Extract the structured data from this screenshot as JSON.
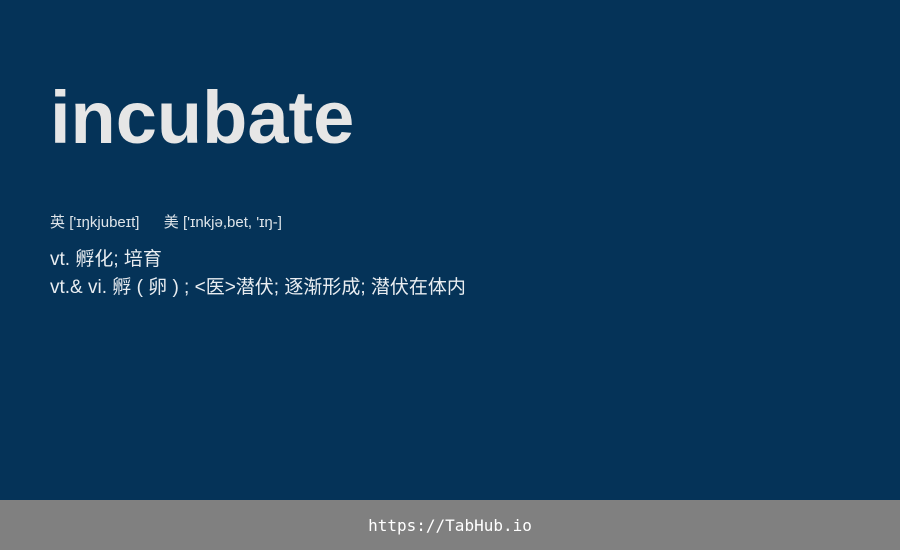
{
  "entry": {
    "word": "incubate",
    "uk_label": "英",
    "uk_phonetic": "['ɪŋkjubeɪt]",
    "us_label": "美",
    "us_phonetic": "['ɪnkjə,bet, 'ɪŋ-]",
    "definitions": [
      "vt. 孵化; 培育",
      "vt.& vi. 孵 ( 卵 ) ; <医>潜伏; 逐渐形成; 潜伏在体内"
    ]
  },
  "footer": {
    "url": "https://TabHub.io"
  },
  "colors": {
    "background": "#053358",
    "footer_background": "#808080",
    "word_text": "#e6e6e6"
  }
}
